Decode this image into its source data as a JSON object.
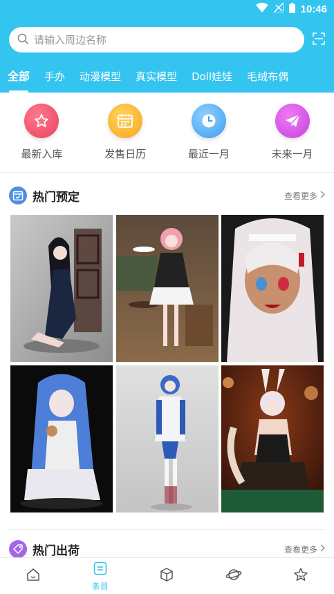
{
  "status": {
    "time": "10:46"
  },
  "search": {
    "placeholder": "请输入周边名称"
  },
  "tabs": [
    {
      "label": "全部",
      "active": true
    },
    {
      "label": "手办"
    },
    {
      "label": "动漫模型"
    },
    {
      "label": "真实模型"
    },
    {
      "label": "Doll娃娃"
    },
    {
      "label": "毛绒布偶"
    }
  ],
  "quick_entries": [
    {
      "label": "最新入库",
      "icon": "star-icon",
      "color": "#f0506e"
    },
    {
      "label": "发售日历",
      "icon": "calendar-icon",
      "color": "#fbb42d"
    },
    {
      "label": "最近一月",
      "icon": "clock-icon",
      "color": "#4aaef0"
    },
    {
      "label": "未来一月",
      "icon": "paper-plane-icon",
      "color": "#d14ee8"
    }
  ],
  "sections": {
    "preorder": {
      "title": "热门预定",
      "more": "查看更多"
    },
    "shipping": {
      "title": "热门出荷",
      "more": "查看更多"
    }
  },
  "products": [
    {
      "name": "figure-black-dress"
    },
    {
      "name": "figure-pink-maid"
    },
    {
      "name": "figure-white-hair-maid"
    },
    {
      "name": "figure-blue-hair-plugsuit"
    },
    {
      "name": "figure-blue-hair-white-dress"
    },
    {
      "name": "figure-bunny-girl"
    }
  ],
  "bottom_nav": [
    {
      "icon": "home-icon",
      "label": ""
    },
    {
      "icon": "list-icon",
      "label": "条目",
      "active": true
    },
    {
      "icon": "box-icon",
      "label": ""
    },
    {
      "icon": "planet-icon",
      "label": ""
    },
    {
      "icon": "star-outline-icon",
      "label": ""
    }
  ],
  "colors": {
    "brand": "#34c4f0",
    "preorder_icon": "#4a90e2",
    "shipping_icon": "#a466e6"
  }
}
